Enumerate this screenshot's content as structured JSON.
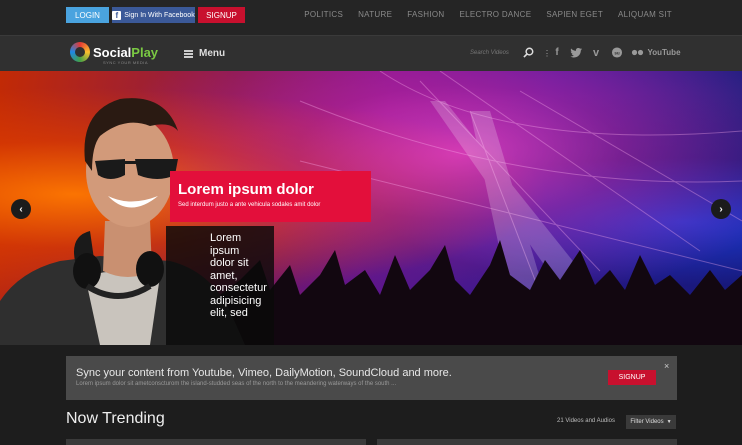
{
  "topbar": {
    "login": "LOGIN",
    "facebook": "Sign In With Facebook",
    "signup": "SIGNUP",
    "nav": [
      "POLITICS",
      "NATURE",
      "FASHION",
      "ELECTRO DANCE",
      "SAPIEN EGET",
      "ALIQUAM SIT"
    ]
  },
  "header": {
    "logo_social": "Social",
    "logo_play": "Play",
    "tagline": "SYNC YOUR MEDIA",
    "menu": "Menu",
    "search_placeholder": "Search Videos",
    "social_icons": [
      "facebook-icon",
      "twitter-icon",
      "vimeo-icon",
      "stumbleupon-icon",
      "flickr-icon",
      "youtube-icon"
    ],
    "youtube": "YouTube"
  },
  "hero": {
    "title": "Lorem ipsum dolor",
    "subtitle": "Sed interdum justo a ante vehicula sodales amit dolor",
    "secondary_text": "Lorem ipsum dolor sit amet, consectetur adipisicing elit, sed",
    "prev": "‹",
    "next": "›"
  },
  "sync": {
    "title": "Sync your content from Youtube, Vimeo, DailyMotion, SoundCloud and more.",
    "subtitle": "Lorem ipsum dolor sit ametconscturom the island-studded seas of the north to the meandering waterways of the south ...",
    "button": "SIGNUP",
    "close": "×"
  },
  "trending": {
    "title": "Now Trending",
    "count": "21 Videos and Audios",
    "filter": "Filter Videos"
  }
}
